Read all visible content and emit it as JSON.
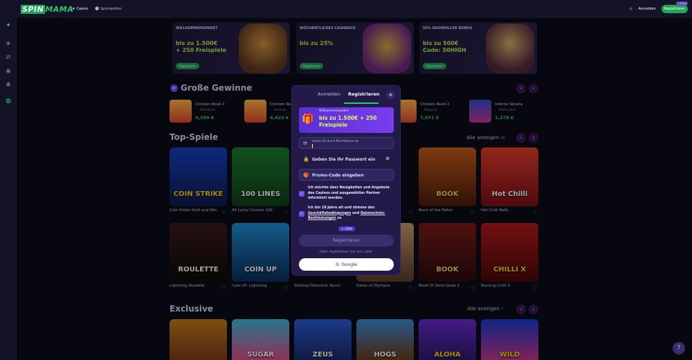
{
  "header": {
    "logo_a": "SPIN",
    "logo_b": "MAMA",
    "tab_casino": "Casino",
    "tab_sports": "Sportwetten",
    "login": "Anmelden",
    "register": "Registrieren",
    "new_badge": "+ bonus"
  },
  "promos": [
    {
      "tag": "WILLKOMMENSPAKET",
      "l1": "bis zu 1.500€",
      "l2": "+ 250 Freispiele",
      "btn": "Registrieren"
    },
    {
      "tag": "WÖCHENTLICHES CASHBACK",
      "l1": "bis zu 25%",
      "l2": "",
      "btn": "Registrieren"
    },
    {
      "tag": "50% HIGHROLLER BONUS",
      "l1": "bis zu 500€",
      "l2": "Code: 50HIGH",
      "btn": "Registrieren"
    }
  ],
  "winners_title": "Große Gewinne",
  "winners": [
    {
      "game": "Chicken Road 2",
      "user": "sOfrietSunz",
      "value": "4,399 €"
    },
    {
      "game": "Chicken Road 2",
      "user": "ikarAnga",
      "value": "4,422 €"
    },
    {
      "game": "Chicken Road 2",
      "user": "Pfeiljuner",
      "value": "7,971 €"
    },
    {
      "game": "Inferno Severa",
      "user": "PeterLurbelt",
      "value": "1,378 €"
    }
  ],
  "top_title": "Top-Spiele",
  "see_all": "Alle anzeigen",
  "see_all_count_top": "40",
  "top_games": [
    {
      "name": "Coin Strike Hold and Win",
      "art": "COIN STRIKE"
    },
    {
      "name": "All Lucky Clovers 100",
      "art": "100 LINES"
    },
    {
      "name": "Book of the Fallen",
      "art": "BOOK"
    },
    {
      "name": "Hot Chilli Bells",
      "art": "Hot Chilli"
    },
    {
      "name": "Lightning Roulette",
      "art": "ROULETTE"
    },
    {
      "name": "Coin UP: Lightning",
      "art": "COIN UP"
    },
    {
      "name": "Striking Diamond: Runni",
      "art": ""
    },
    {
      "name": "Gates of Olympus",
      "art": ""
    },
    {
      "name": "Book Of Demi Gods 2",
      "art": "BOOK"
    },
    {
      "name": "Burning Chilli X",
      "art": "CHILLI X"
    }
  ],
  "exclusive_title": "Exclusive",
  "see_all_count_ex": "7",
  "exclusive_games": [
    "",
    "SUGAR",
    "ZEUS",
    "HOGS",
    "ALOHA",
    "WILD"
  ],
  "modal": {
    "tab_login": "Anmelden",
    "tab_register": "Registrieren",
    "bonus_l1": "Willkommenspaket",
    "bonus_l2": "bis zu 1.500€ + 250 Freispiele",
    "email_label": "Geben Sie Ihre E-Mail-Adresse ein",
    "password_placeholder": "Geben Sie Ihr Passwort ein",
    "promo_placeholder": "Promo-Code eingeben",
    "check1": "Ich möchte über Neuigkeiten und Angebote des Casinos und ausgewählter Partner informiert werden.",
    "check2_a": "Ich bin 18 Jahre alt und stimme den",
    "check2_link1": "Geschäftsbedingungen",
    "check2_and": "und",
    "check2_link2": "Datenschutz-Bestimmungen",
    "check2_b": "zu",
    "progress": "100%",
    "submit": "Registrieren",
    "or": "Oder registrieren Sie sich über",
    "google": "Google"
  },
  "colors": {
    "accent": "#1fd168",
    "modal_bg": "#231a4a",
    "purple": "#6d4df2"
  }
}
